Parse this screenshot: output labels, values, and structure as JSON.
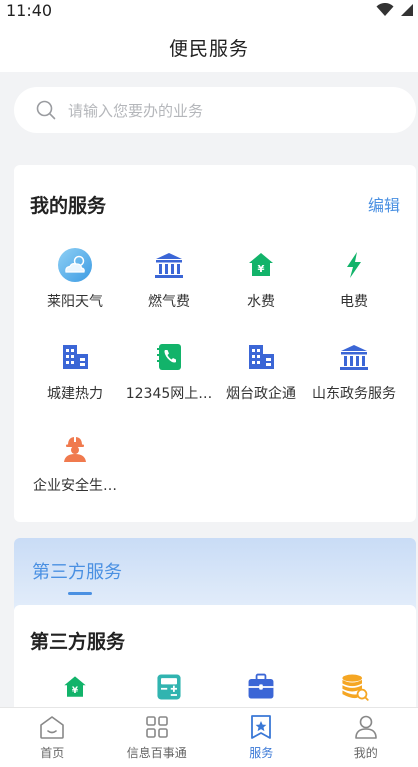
{
  "status": {
    "time": "11:40"
  },
  "header": {
    "title": "便民服务"
  },
  "search": {
    "placeholder": "请输入您要办的业务"
  },
  "my_services": {
    "title": "我的服务",
    "edit_label": "编辑",
    "items": [
      {
        "label": "莱阳天气",
        "icon": "weather-icon"
      },
      {
        "label": "燃气费",
        "icon": "bank-icon"
      },
      {
        "label": "水费",
        "icon": "house-yuan-icon"
      },
      {
        "label": "电费",
        "icon": "lightning-icon"
      },
      {
        "label": "城建热力",
        "icon": "building-icon"
      },
      {
        "label": "12345网上…",
        "icon": "phone-book-icon"
      },
      {
        "label": "烟台政企通",
        "icon": "building-icon"
      },
      {
        "label": "山东政务服务",
        "icon": "bank-icon"
      },
      {
        "label": "企业安全生…",
        "icon": "worker-icon"
      }
    ]
  },
  "third_party_banner": {
    "label": "第三方服务"
  },
  "third_party_card": {
    "title": "第三方服务",
    "items": [
      {
        "icon": "house-yuan-icon"
      },
      {
        "icon": "calculator-icon"
      },
      {
        "icon": "briefcase-icon"
      },
      {
        "icon": "coin-search-icon"
      }
    ]
  },
  "tabbar": {
    "tabs": [
      {
        "label": "首页",
        "icon": "home-icon",
        "active": false
      },
      {
        "label": "信息百事通",
        "icon": "grid-icon",
        "active": false
      },
      {
        "label": "服务",
        "icon": "star-bookmark-icon",
        "active": true
      },
      {
        "label": "我的",
        "icon": "user-icon",
        "active": false
      }
    ]
  },
  "colors": {
    "accent": "#4a90e2",
    "icon_blue": "#3b66d6",
    "icon_green": "#12b36a",
    "icon_orange": "#f07a4e",
    "icon_gold": "#f5a623",
    "icon_teal": "#31b4b0"
  }
}
